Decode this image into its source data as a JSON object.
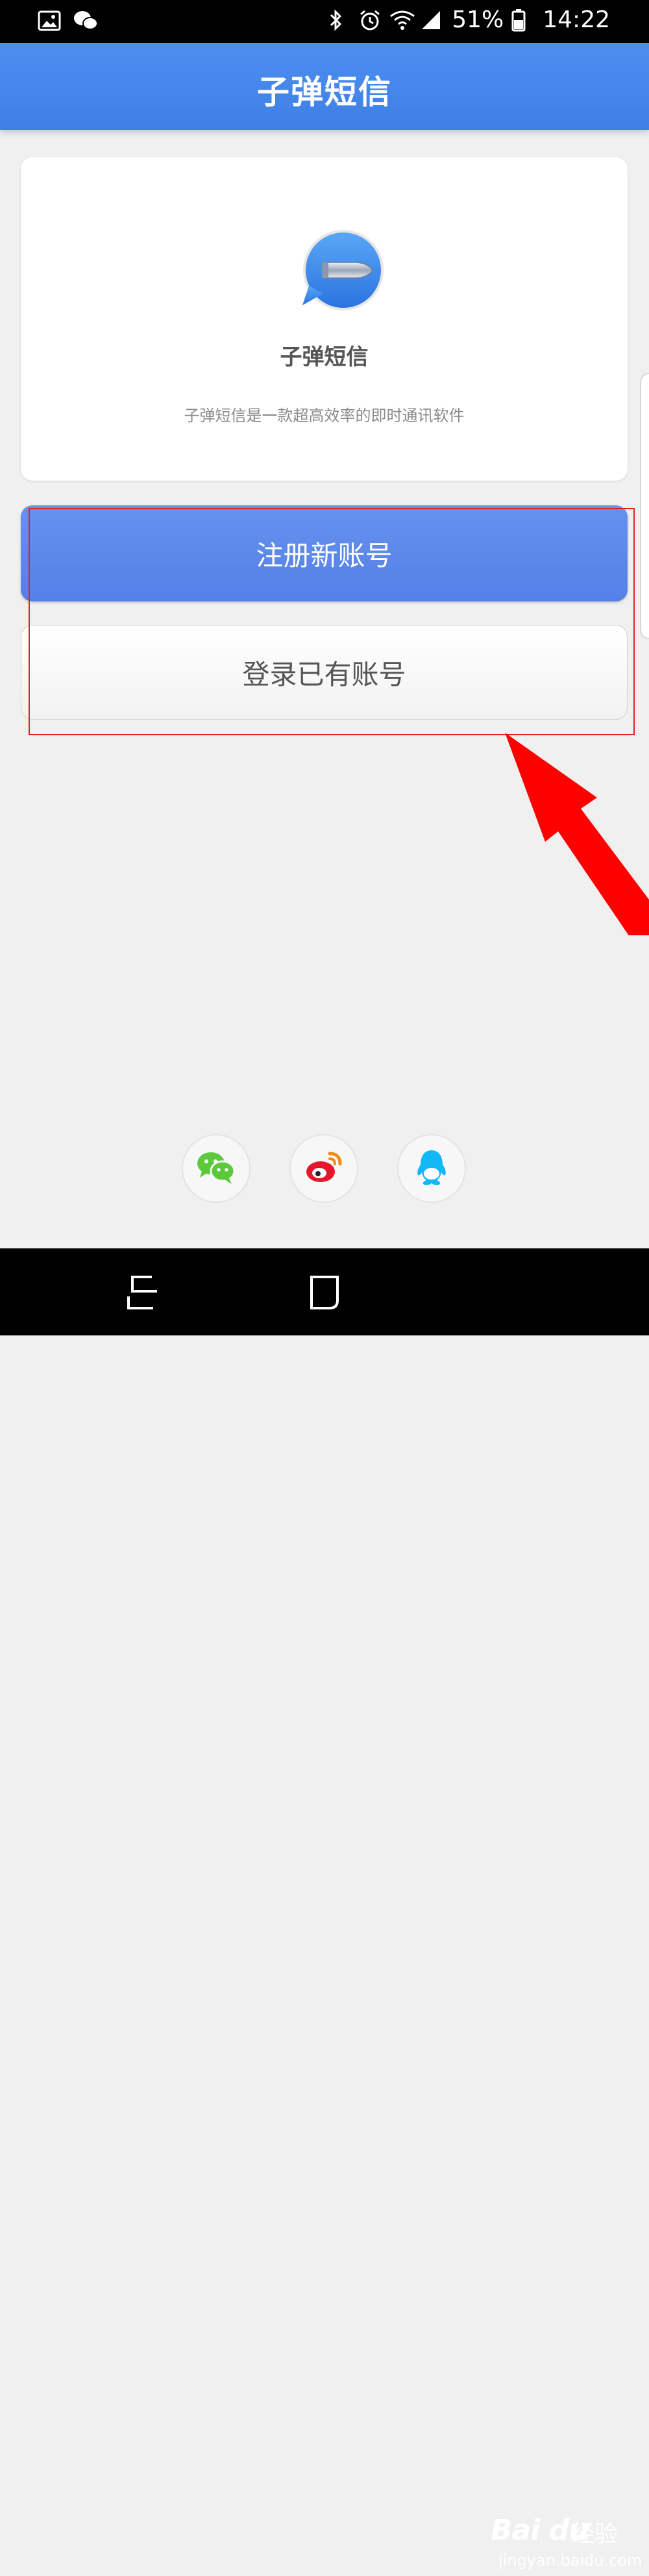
{
  "status_bar": {
    "battery_percent": "51%",
    "time": "14:22",
    "left_icons": [
      "gallery-icon",
      "wechat-notification-icon"
    ],
    "right_icons": [
      "bluetooth-icon",
      "alarm-icon",
      "wifi-icon",
      "signal-icon",
      "battery-icon"
    ]
  },
  "header": {
    "title": "子弹短信"
  },
  "app_card": {
    "name": "子弹短信",
    "description": "子弹短信是一款超高效率的即时通讯软件",
    "logo_icon": "bullet-message-logo-icon"
  },
  "actions": {
    "register_label": "注册新账号",
    "login_label": "登录已有账号"
  },
  "social_login": [
    {
      "icon": "wechat-icon",
      "color": "#5cc93b"
    },
    {
      "icon": "weibo-icon",
      "color": "#e6162d"
    },
    {
      "icon": "qq-icon",
      "color": "#12b7f5"
    }
  ],
  "annotation": {
    "box_color": "#e52020",
    "arrow_color": "#ff0000"
  },
  "watermark": {
    "logo": "Bai du",
    "text": "经验",
    "url": "jingyan.baidu.com"
  },
  "colors": {
    "header_blue": "#4587ec",
    "register_blue": "#5d88ea"
  }
}
